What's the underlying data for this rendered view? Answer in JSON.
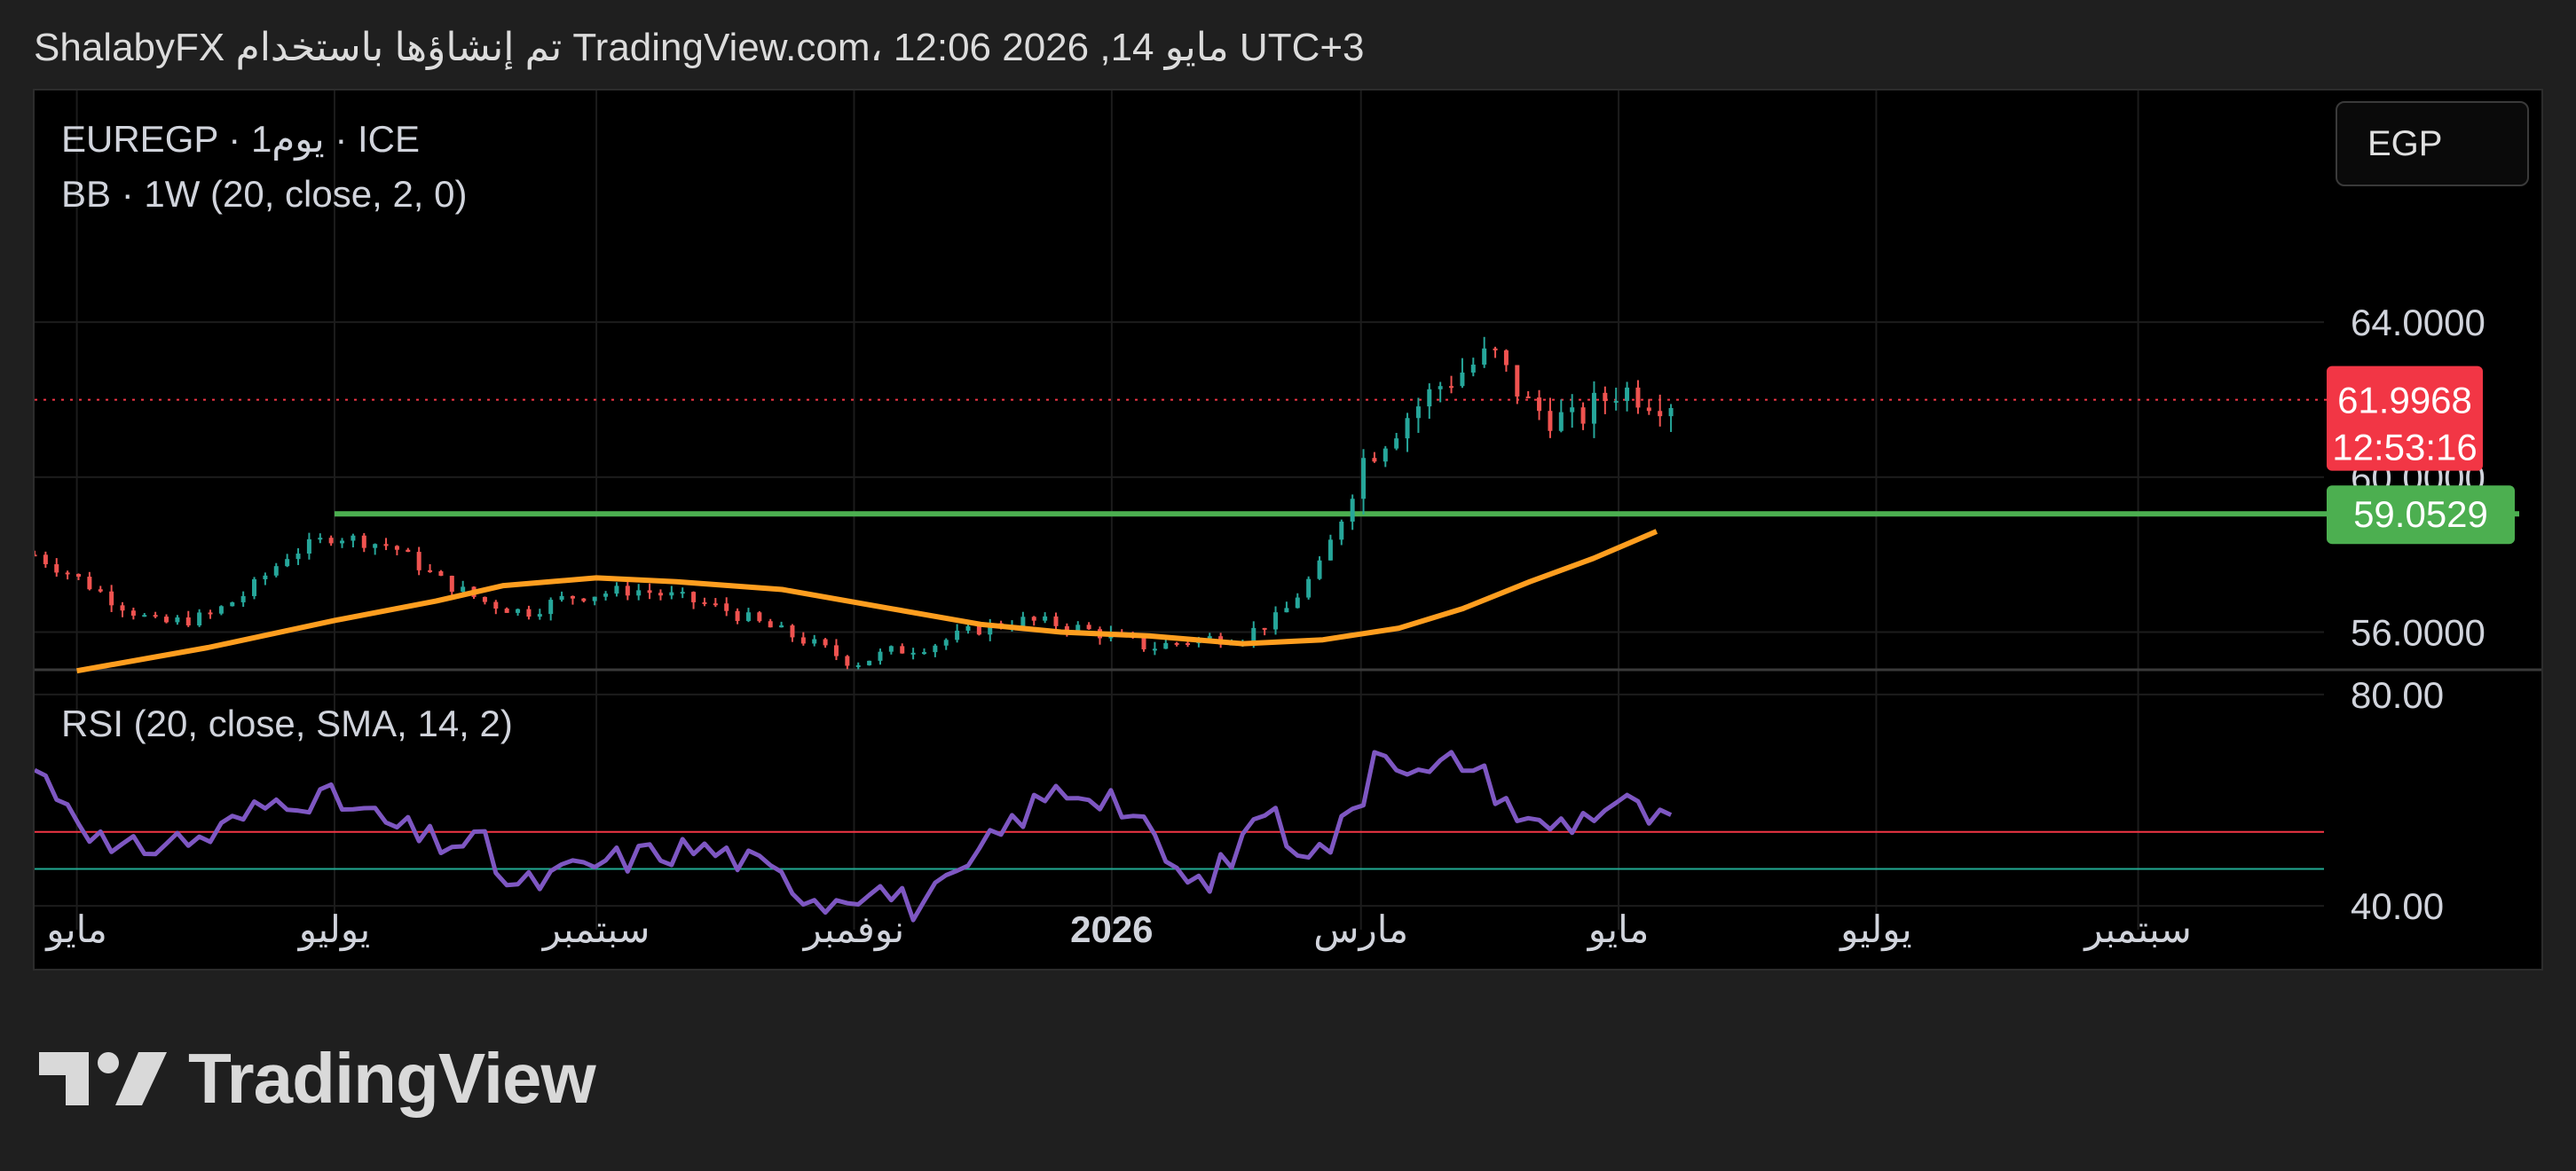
{
  "header": {
    "text": "ShalabyFX تم إنشاؤها باستخدام TradingView.com، 12:06 2026 ,14 مايو UTC+3"
  },
  "legend": {
    "symbol": "EUREGP · 1يوم · ICE",
    "bb": "BB · 1W (20, close, 2, 0)",
    "rsi": "RSI (20, close, SMA, 14, 2)"
  },
  "currency": "EGP",
  "brand": {
    "name": "TradingView",
    "icon": "tradingview-logo-icon"
  },
  "colors": {
    "background": "#000000",
    "page_background": "#1f1f1f",
    "candle_up": "#26a69a",
    "candle_down": "#ef5350",
    "bb_basis": "#ff9e1f",
    "support_line": "#4caf50",
    "rsi_line": "#7e57c2",
    "rsi_upper_band": "#f23645",
    "rsi_lower_band": "#22ab94",
    "price_label": "#f23645",
    "support_label": "#4caf50"
  },
  "chart_data": [
    {
      "type": "candlestick",
      "title": "EUREGP · 1يوم · ICE",
      "y_ticks": [
        "64.0000",
        "56.0000",
        "60.0000"
      ],
      "ylim": [
        55.05,
        69.98
      ],
      "x_ticks": [
        "مايو",
        "يوليو",
        "سبتمبر",
        "نوفمبر",
        "2026",
        "مارس",
        "مايو",
        "يوليو",
        "سبتمبر"
      ],
      "grid": true,
      "current_price": {
        "value": 61.9968,
        "label": "61.9968",
        "countdown": "12:53:16"
      },
      "support": {
        "value": 59.0529,
        "label": "59.0529"
      },
      "close_path": {
        "dates": [
          "2025-04-21",
          "2025-05-01",
          "2025-05-10",
          "2025-05-20",
          "2025-06-01",
          "2025-06-10",
          "2025-06-20",
          "2025-07-01",
          "2025-07-15",
          "2025-07-25",
          "2025-08-05",
          "2025-08-15",
          "2025-08-25",
          "2025-09-10",
          "2025-09-20",
          "2025-10-01",
          "2025-10-10",
          "2025-10-20",
          "2025-11-01",
          "2025-11-10",
          "2025-11-20",
          "2025-12-01",
          "2025-12-10",
          "2025-12-20",
          "2026-01-01",
          "2026-01-10",
          "2026-01-20",
          "2026-02-01",
          "2026-02-10",
          "2026-02-20",
          "2026-03-01",
          "2026-03-10",
          "2026-03-20",
          "2026-04-01",
          "2026-04-10",
          "2026-04-20",
          "2026-05-01",
          "2026-05-10"
        ],
        "values": [
          58.0,
          57.4,
          56.8,
          56.2,
          56.4,
          57.0,
          58.0,
          58.5,
          58.2,
          57.4,
          56.8,
          56.5,
          56.9,
          57.1,
          56.9,
          56.6,
          56.2,
          55.8,
          55.2,
          55.5,
          55.7,
          56.1,
          56.3,
          56.2,
          55.9,
          55.6,
          55.8,
          55.9,
          56.4,
          57.8,
          60.4,
          61.4,
          62.4,
          63.2,
          61.8,
          61.4,
          62.3,
          62.0
        ]
      },
      "series": [
        {
          "name": "BB",
          "dates": [
            "2025-05-01",
            "2025-06-01",
            "2025-07-01",
            "2025-07-25",
            "2025-08-10",
            "2025-09-01",
            "2025-09-20",
            "2025-10-15",
            "2025-11-10",
            "2025-12-01",
            "2025-12-20",
            "2026-01-10",
            "2026-02-01",
            "2026-02-20",
            "2026-03-10",
            "2026-03-25",
            "2026-04-10",
            "2026-04-25",
            "2026-05-10"
          ],
          "values": [
            55.0,
            55.6,
            56.3,
            56.8,
            57.2,
            57.4,
            57.3,
            57.1,
            56.6,
            56.2,
            56.0,
            55.9,
            55.7,
            55.8,
            56.1,
            56.6,
            57.3,
            57.9,
            58.6
          ]
        }
      ]
    },
    {
      "type": "line",
      "title": "RSI (20, close, SMA, 14, 2)",
      "y_ticks": [
        "80.00",
        "40.00"
      ],
      "ylim": [
        35.5,
        84.5
      ],
      "upper_band": 54.0,
      "lower_band": 47.0,
      "series": [
        {
          "name": "RSI",
          "dates": [
            "2025-04-21",
            "2025-05-01",
            "2025-05-10",
            "2025-05-20",
            "2025-06-01",
            "2025-06-10",
            "2025-06-20",
            "2025-07-01",
            "2025-07-15",
            "2025-07-25",
            "2025-08-05",
            "2025-08-12",
            "2025-08-20",
            "2025-09-01",
            "2025-09-15",
            "2025-09-25",
            "2025-10-05",
            "2025-10-15",
            "2025-10-25",
            "2025-11-05",
            "2025-11-15",
            "2025-11-25",
            "2025-12-01",
            "2025-12-10",
            "2025-12-20",
            "2026-01-01",
            "2026-01-10",
            "2026-01-20",
            "2026-01-30",
            "2026-02-05",
            "2026-02-12",
            "2026-02-20",
            "2026-03-01",
            "2026-03-05",
            "2026-03-15",
            "2026-03-25",
            "2026-04-01",
            "2026-04-10",
            "2026-04-20",
            "2026-05-01",
            "2026-05-10",
            "2026-05-14"
          ],
          "values": [
            66.0,
            58.0,
            49.0,
            52.0,
            53.0,
            57.0,
            61.0,
            60.0,
            55.0,
            52.0,
            52.0,
            43.0,
            45.0,
            48.0,
            50.0,
            51.0,
            49.0,
            45.0,
            41.0,
            44.0,
            40.0,
            44.0,
            50.0,
            57.0,
            62.0,
            61.0,
            53.0,
            43.0,
            49.0,
            60.0,
            53.0,
            50.0,
            60.0,
            72.0,
            64.0,
            68.0,
            63.0,
            55.0,
            56.0,
            60.0,
            56.0,
            55.0
          ]
        }
      ]
    }
  ]
}
